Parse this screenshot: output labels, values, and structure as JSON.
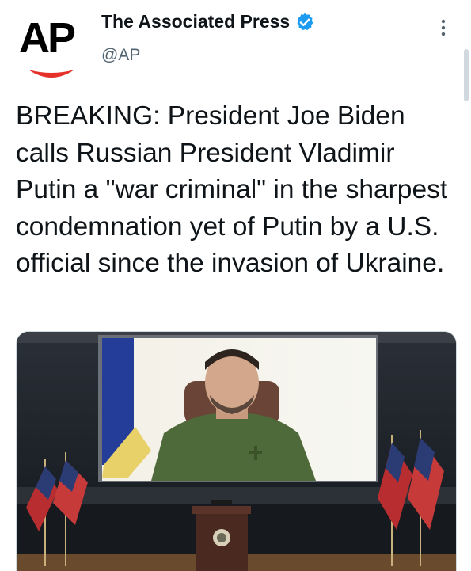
{
  "tweet": {
    "author": {
      "logo_text": "AP",
      "display_name": "The Associated Press",
      "handle": "@AP",
      "verified": true,
      "verified_color": "#1d9bf0"
    },
    "text": "BREAKING: President Joe Biden calls Russian President Vladimir Putin a \"war criminal\" in the sharpest condemnation yet of Putin by a U.S. official since the invasion of Ukraine.",
    "media": {
      "description_icon": "photo",
      "accent_colors": {
        "logo_smile": "#e4322b",
        "shirt": "#4f6a3a"
      }
    }
  },
  "icons": {
    "more": "more-vertical-icon",
    "verified": "verified-badge-icon"
  }
}
